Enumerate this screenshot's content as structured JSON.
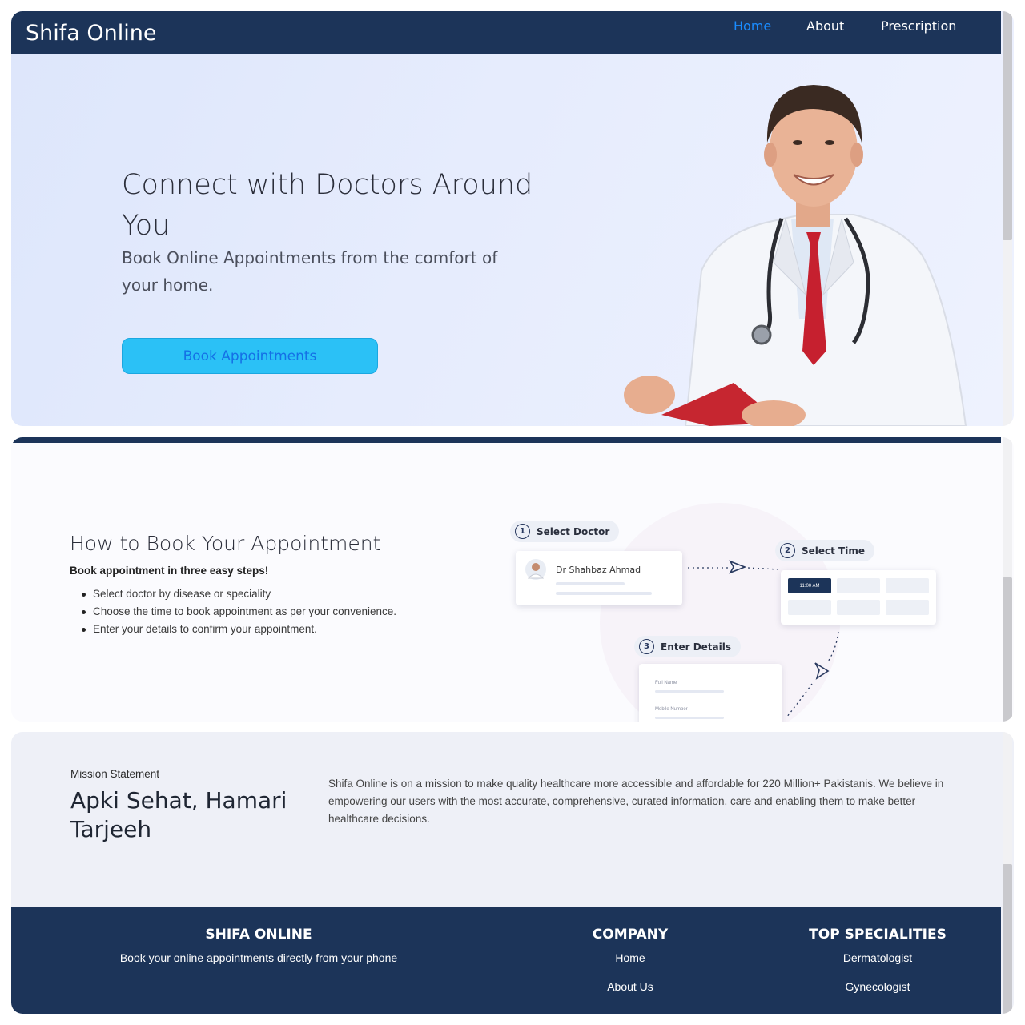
{
  "navbar": {
    "brand": "Shifa Online",
    "links": [
      {
        "label": "Home",
        "active": true
      },
      {
        "label": "About"
      },
      {
        "label": "Prescription"
      }
    ]
  },
  "hero": {
    "title": "Connect with Doctors Around You",
    "subtitle": "Book Online Appointments from the comfort of your home.",
    "button_label": "Book Appointments"
  },
  "how_to": {
    "title": "How to Book Your Appointment",
    "intro": "Book appointment in three easy steps!",
    "steps": [
      "Select doctor by disease or speciality",
      "Choose the time to book appointment as per your convenience.",
      "Enter your details to confirm your appointment."
    ],
    "flow": {
      "step1": {
        "num": "1",
        "label": "Select Doctor"
      },
      "step2": {
        "num": "2",
        "label": "Select Time"
      },
      "step3": {
        "num": "3",
        "label": "Enter Details"
      },
      "doctor_name": "Dr Shahbaz Ahmad",
      "selected_slot": "11:00 AM",
      "field_full_name": "Full Name",
      "field_mobile": "Mobile Number"
    }
  },
  "mission": {
    "label": "Mission Statement",
    "title": "Apki Sehat, Hamari Tarjeeh",
    "text": "Shifa Online is on a mission to make quality healthcare more accessible and affordable for 220 Million+ Pakistanis. We believe in empowering our users with the most accurate, comprehensive, curated information, care and enabling them to make better healthcare decisions."
  },
  "footer": {
    "brand_heading": "SHIFA ONLINE",
    "brand_text": "Book your online appointments directly from your phone",
    "company_heading": "COMPANY",
    "company_links": [
      "Home",
      "About Us"
    ],
    "specialities_heading": "TOP SPECIALITIES",
    "specialities": [
      "Dermatologist",
      "Gynecologist"
    ]
  },
  "colors": {
    "navy": "#1c3459",
    "accent_blue": "#1a8cff",
    "button_cyan": "#2bc1f6"
  }
}
